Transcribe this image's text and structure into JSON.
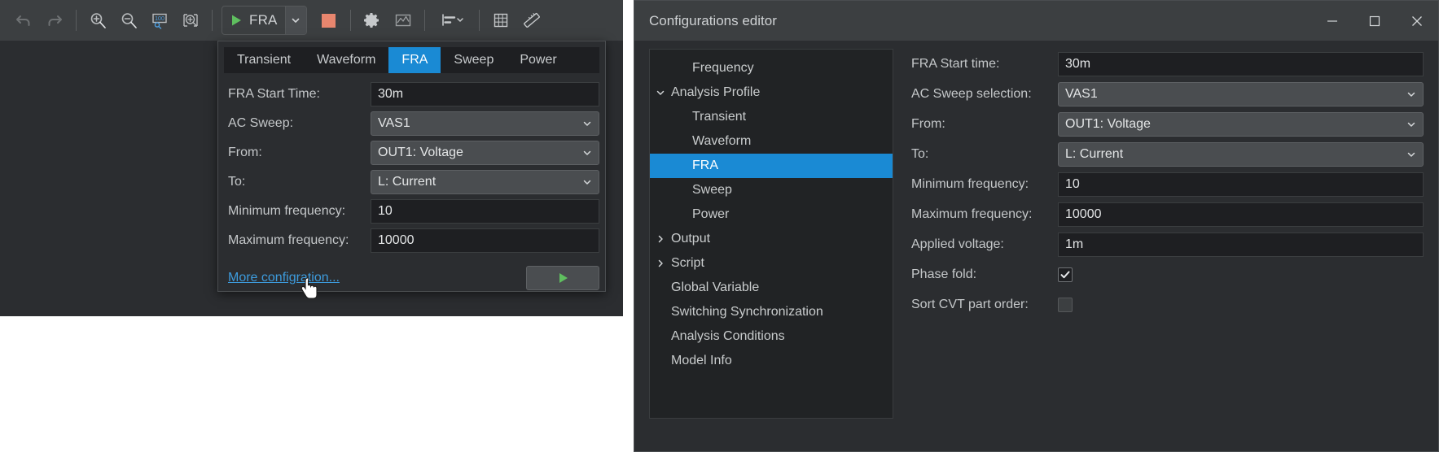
{
  "left_window": {
    "toolbar": {
      "items": [
        {
          "name": "undo-icon",
          "label": "Undo"
        },
        {
          "name": "redo-icon",
          "label": "Redo"
        },
        {
          "name": "zoom-in-icon",
          "label": "Zoom in"
        },
        {
          "name": "zoom-out-icon",
          "label": "Zoom out"
        },
        {
          "name": "zoom-100-icon",
          "label": "Zoom 100%"
        },
        {
          "name": "zoom-fit-icon",
          "label": "Zoom to fit"
        },
        {
          "name": "settings-gear-icon",
          "label": "Settings"
        },
        {
          "name": "waveform-viewer-icon",
          "label": "Waveform viewer"
        },
        {
          "name": "align-icon",
          "label": "Align"
        },
        {
          "name": "grid-icon",
          "label": "Grid"
        },
        {
          "name": "ruler-icon",
          "label": "Measure"
        }
      ],
      "run_label": "FRA",
      "run_icon": "play-triangle-icon",
      "dropdown_icon": "chevron-down-icon",
      "stop_icon": "stop-square-icon",
      "zoom_100_text": "100"
    },
    "popup": {
      "tabs": [
        {
          "label": "Transient",
          "active": false
        },
        {
          "label": "Waveform",
          "active": false
        },
        {
          "label": "FRA",
          "active": true
        },
        {
          "label": "Sweep",
          "active": false
        },
        {
          "label": "Power",
          "active": false
        }
      ],
      "fields": [
        {
          "label": "FRA Start Time:",
          "value": "30m",
          "type": "text"
        },
        {
          "label": "AC Sweep:",
          "value": "VAS1",
          "type": "combo"
        },
        {
          "label": "From:",
          "value": "OUT1: Voltage",
          "type": "combo"
        },
        {
          "label": "To:",
          "value": "L: Current",
          "type": "combo"
        },
        {
          "label": "Minimum frequency:",
          "value": "10",
          "type": "text"
        },
        {
          "label": "Maximum frequency:",
          "value": "10000",
          "type": "text"
        }
      ],
      "more_config_label": "More configration...",
      "run_button_icon": "play-triangle-icon"
    }
  },
  "dialog": {
    "title": "Configurations editor",
    "window_controls": [
      {
        "name": "minimize-button",
        "glyph": "—"
      },
      {
        "name": "maximize-button",
        "glyph": "☐"
      },
      {
        "name": "close-button",
        "glyph": "✕"
      }
    ],
    "tree": [
      {
        "label": "Frequency",
        "indent": 1,
        "twisty": "",
        "selected": false
      },
      {
        "label": "Analysis Profile",
        "indent": 0,
        "twisty": "down",
        "selected": false
      },
      {
        "label": "Transient",
        "indent": 2,
        "twisty": "",
        "selected": false
      },
      {
        "label": "Waveform",
        "indent": 2,
        "twisty": "",
        "selected": false
      },
      {
        "label": "FRA",
        "indent": 2,
        "twisty": "",
        "selected": true
      },
      {
        "label": "Sweep",
        "indent": 2,
        "twisty": "",
        "selected": false
      },
      {
        "label": "Power",
        "indent": 2,
        "twisty": "",
        "selected": false
      },
      {
        "label": "Output",
        "indent": 0,
        "twisty": "right",
        "selected": false
      },
      {
        "label": "Script",
        "indent": 0,
        "twisty": "right",
        "selected": false
      },
      {
        "label": "Global Variable",
        "indent": 1,
        "twisty": "",
        "selected": false
      },
      {
        "label": "Switching Synchronization",
        "indent": 1,
        "twisty": "",
        "selected": false
      },
      {
        "label": "Analysis Conditions",
        "indent": 1,
        "twisty": "",
        "selected": false
      },
      {
        "label": "Model Info",
        "indent": 1,
        "twisty": "",
        "selected": false
      }
    ],
    "fields": [
      {
        "label": "FRA Start time:",
        "value": "30m",
        "type": "text"
      },
      {
        "label": "AC Sweep selection:",
        "value": "VAS1",
        "type": "combo"
      },
      {
        "label": "From:",
        "value": "OUT1: Voltage",
        "type": "combo"
      },
      {
        "label": "To:",
        "value": "L: Current",
        "type": "combo"
      },
      {
        "label": "Minimum frequency:",
        "value": "10",
        "type": "text"
      },
      {
        "label": "Maximum frequency:",
        "value": "10000",
        "type": "text"
      },
      {
        "label": "Applied voltage:",
        "value": "1m",
        "type": "text"
      },
      {
        "label": "Phase fold:",
        "value": true,
        "type": "checkbox"
      },
      {
        "label": "Sort CVT part order:",
        "value": false,
        "type": "checkbox"
      }
    ]
  },
  "colors": {
    "accent_blue": "#1a8ad4",
    "link_blue": "#3d9bdc",
    "play_green": "#5fbf5f",
    "stop_red": "#e8866e",
    "toolbar_bg": "#3c3f41",
    "window_bg": "#2b2d30",
    "field_bg": "#1e1f22"
  }
}
